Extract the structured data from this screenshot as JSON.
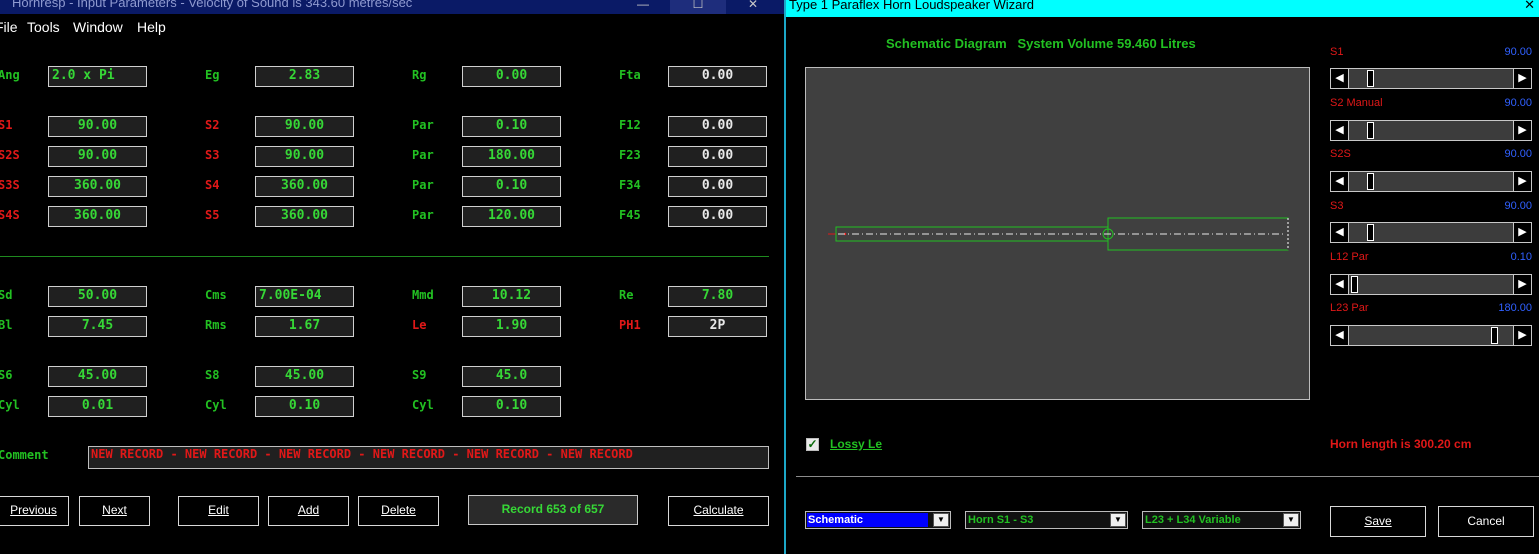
{
  "left_window": {
    "title": "Hornresp - Input Parameters - Velocity of Sound is 343.60 metres/sec",
    "window_buttons": [
      "—",
      "☐",
      "✕"
    ],
    "menu": [
      "File",
      "Tools",
      "Window",
      "Help"
    ],
    "fields": [
      {
        "label": "Ang",
        "value": "2.0 x Pi"
      },
      {
        "label": "Eg",
        "value": "2.83"
      },
      {
        "label": "Rg",
        "value": "0.00"
      },
      {
        "label": "Fta",
        "value": "0.00"
      },
      {
        "label": "S1",
        "value": "90.00"
      },
      {
        "label": "S2",
        "value": "90.00"
      },
      {
        "label": "Par",
        "value": "0.10"
      },
      {
        "label": "F12",
        "value": "0.00"
      },
      {
        "label": "S2S",
        "value": "90.00"
      },
      {
        "label": "S3",
        "value": "90.00"
      },
      {
        "label": "Par",
        "value": "180.00"
      },
      {
        "label": "F23",
        "value": "0.00"
      },
      {
        "label": "S3S",
        "value": "360.00"
      },
      {
        "label": "S4",
        "value": "360.00"
      },
      {
        "label": "Par",
        "value": "0.10"
      },
      {
        "label": "F34",
        "value": "0.00"
      },
      {
        "label": "S4S",
        "value": "360.00"
      },
      {
        "label": "S5",
        "value": "360.00"
      },
      {
        "label": "Par",
        "value": "120.00"
      },
      {
        "label": "F45",
        "value": "0.00"
      },
      {
        "label": "Sd",
        "value": "50.00"
      },
      {
        "label": "Cms",
        "value": "7.00E-04"
      },
      {
        "label": "Mmd",
        "value": "10.12"
      },
      {
        "label": "Re",
        "value": "7.80"
      },
      {
        "label": "Bl",
        "value": "7.45"
      },
      {
        "label": "Rms",
        "value": "1.67"
      },
      {
        "label": "Le",
        "value": "1.90"
      },
      {
        "label": "PH1",
        "value": "2P"
      },
      {
        "label": "S6",
        "value": "45.00"
      },
      {
        "label": "S8",
        "value": "45.00"
      },
      {
        "label": "S9",
        "value": "45.0"
      },
      {
        "label": "Cyl",
        "value": "0.01"
      },
      {
        "label": "Cyl",
        "value": "0.10"
      },
      {
        "label": "Cyl",
        "value": "0.10"
      }
    ],
    "comment_label": "Comment",
    "comment_value": "NEW RECORD - NEW RECORD - NEW RECORD - NEW RECORD - NEW RECORD - NEW RECORD",
    "buttons": {
      "previous": "Previous",
      "next": "Next",
      "edit": "Edit",
      "add": "Add",
      "delete": "Delete",
      "calculate": "Calculate"
    },
    "record_status": "Record 653 of 657"
  },
  "right_window": {
    "title": "Type 1 Paraflex Horn Loudspeaker Wizard",
    "close": "✕",
    "schematic_title": "Schematic Diagram   System Volume 59.460 Litres",
    "sliders": [
      {
        "label": "S1",
        "value": "90.00",
        "position": 0.12
      },
      {
        "label": "S2  Manual",
        "value": "90.00",
        "position": 0.12
      },
      {
        "label": "S2S",
        "value": "90.00",
        "position": 0.12
      },
      {
        "label": "S3",
        "value": "90.00",
        "position": 0.12
      },
      {
        "label": "L12  Par",
        "value": "0.10",
        "position": 0.02
      },
      {
        "label": "L23  Par",
        "value": "180.00",
        "position": 0.9
      }
    ],
    "lossy_label": "Lossy Le",
    "lossy_checked": "✓",
    "horn_length": "Horn length is 300.20 cm",
    "combos": [
      "Schematic",
      "Horn S1 - S3",
      "L23 + L34 Variable"
    ],
    "combo_arrow": "▼",
    "save": "Save",
    "cancel": "Cancel"
  },
  "colors": {
    "label_green": "#22c022",
    "label_red": "#e01818",
    "value_green": "#36d836",
    "slider_value_blue": "#3060ff",
    "accent_cyan": "#00ffff"
  }
}
